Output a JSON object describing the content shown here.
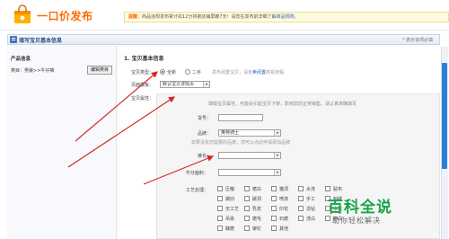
{
  "header": {
    "title": "一口价发布",
    "notice_prefix": "提醒：",
    "notice_text": "商品违规发布累计扣12分将被店铺屏蔽7天！请您在发布前详细了解",
    "notice_link": "商品规则。"
  },
  "panel": {
    "title": "填写宝贝基本信息",
    "required_hint": "* 表示该项必填"
  },
  "left": {
    "heading": "产品信息",
    "category": "类目：男装>>牛仔裤",
    "edit_button": "编辑类目"
  },
  "main": {
    "section_title": "1. 宝贝基本信息",
    "type_label": "宝贝类型：",
    "type_new": "全新",
    "type_used": "二手",
    "type_note": "发布闲置宝贝，请走",
    "type_note_link": "卖闲置",
    "type_note_tail": "简易流程",
    "page_template_label": "页面模板：",
    "page_template_value": "默认宝贝详情页",
    "attr_label": "宝贝属性：",
    "attr_hint": "填错宝贝属性，可能会引起宝贝下架，影响您的正常销售。请认真准确填写",
    "model_label": "货号：",
    "model_value": "",
    "brand_label": "品牌：",
    "brand_value": "奥特骑士",
    "brand_note": "如果没有您需要的品牌，您可以点此申请添加品牌",
    "waist_label": "裤长：",
    "waist_value": "",
    "denim_label": "牛仔面料：",
    "denim_value": "",
    "craft_label": "工艺处理：",
    "crafts": [
      "压皱",
      "磨白",
      "猫须",
      "水洗",
      "贴布",
      "做旧",
      "破洞",
      "喷漆",
      "手工",
      "刺绣",
      "无工艺",
      "乳浆",
      "印花",
      "烫钻",
      "水洗",
      "吊染",
      "磨毛",
      "石磨",
      "洗白",
      "磨白",
      "酵磨",
      "铆钉",
      "其他"
    ]
  },
  "watermark": {
    "main": "百科全说",
    "sub": "助你轻松解决"
  },
  "colors": {
    "accent_orange": "#ff6a00",
    "link_blue": "#1e5fb6",
    "arrow_red": "#d42a2a",
    "watermark_green": "#1aa34a"
  }
}
